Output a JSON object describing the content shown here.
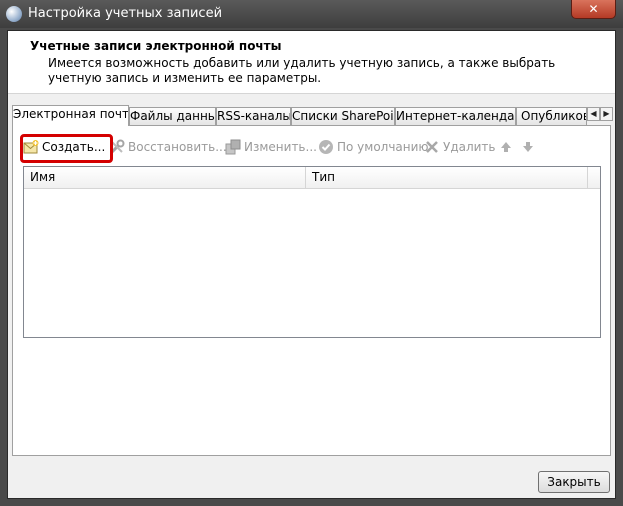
{
  "window": {
    "title": "Настройка учетных записей",
    "close_label": "✕"
  },
  "header": {
    "title": "Учетные записи электронной почты",
    "description": "Имеется возможность добавить или удалить учетную запись, а также выбрать учетную запись и изменить ее параметры."
  },
  "tabs": [
    {
      "label": "Электронная почта",
      "active": true
    },
    {
      "label": "Файлы данных"
    },
    {
      "label": "RSS-каналы"
    },
    {
      "label": "Списки SharePoint"
    },
    {
      "label": "Интернет-календари"
    },
    {
      "label": "Опубликованные календари"
    }
  ],
  "toolbar": {
    "create": "Создать...",
    "restore": "Восстановить...",
    "change": "Изменить...",
    "default": "По умолчанию",
    "delete": "Удалить"
  },
  "list": {
    "columns": [
      "Имя",
      "Тип"
    ],
    "rows": []
  },
  "footer": {
    "close_label": "Закрыть"
  },
  "colors": {
    "highlight": "#d40000",
    "titlebar": "#4a4a4a",
    "close_button": "#c7472f"
  }
}
